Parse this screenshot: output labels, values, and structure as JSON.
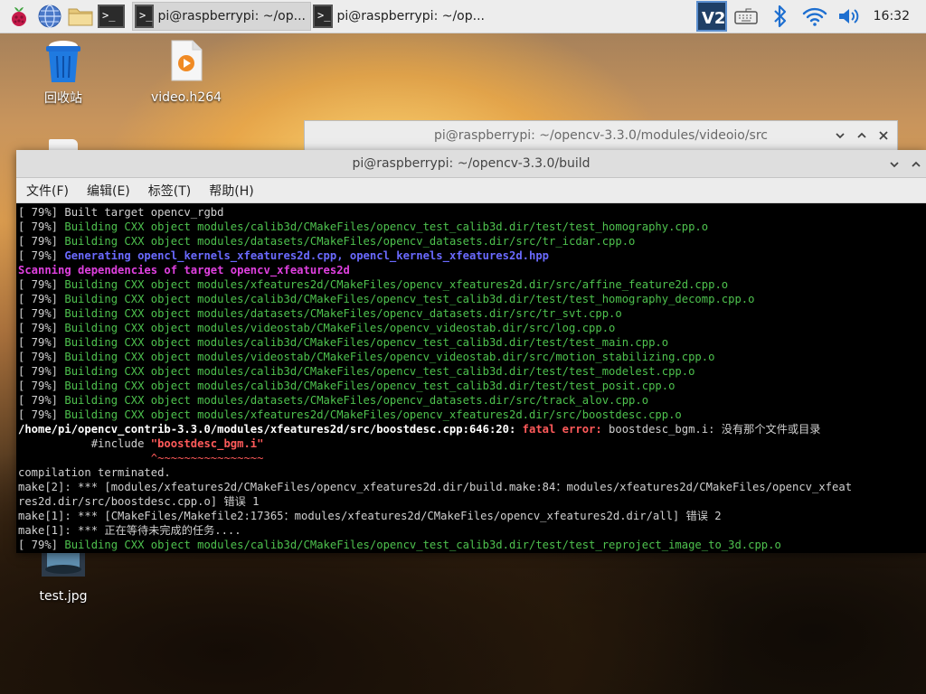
{
  "taskbar": {
    "launchers": [
      "raspberry-menu-icon",
      "browser-icon",
      "file-manager-icon",
      "terminal-icon"
    ],
    "tasks": [
      {
        "label": "pi@raspberrypi: ~/op...",
        "active": true
      },
      {
        "label": "pi@raspberrypi: ~/op...",
        "active": false
      }
    ],
    "tray": [
      "vnc-icon",
      "keyboard-icon",
      "bluetooth-icon",
      "wifi-icon",
      "volume-icon"
    ],
    "clock": "16:32"
  },
  "desktop": {
    "icons": [
      {
        "label": "回收站",
        "icon": "trash-icon"
      },
      {
        "label": "video.h264",
        "icon": "video-file-icon"
      },
      {
        "label": "test.jpg",
        "icon": "image-file-icon"
      }
    ]
  },
  "background_window": {
    "title": "pi@raspberrypi: ~/opencv-3.3.0/modules/videoio/src"
  },
  "terminal": {
    "title": "pi@raspberrypi: ~/opencv-3.3.0/build",
    "menu": [
      "文件(F)",
      "编辑(E)",
      "标签(T)",
      "帮助(H)"
    ],
    "lines": [
      [
        {
          "t": "[ 79%] Built target opencv_rgbd",
          "c": ""
        }
      ],
      [
        {
          "t": "[ 79%] ",
          "c": ""
        },
        {
          "t": "Building CXX object modules/calib3d/CMakeFiles/opencv_test_calib3d.dir/test/test_homography.cpp.o",
          "c": "g"
        }
      ],
      [
        {
          "t": "[ 79%] ",
          "c": ""
        },
        {
          "t": "Building CXX object modules/datasets/CMakeFiles/opencv_datasets.dir/src/tr_icdar.cpp.o",
          "c": "g"
        }
      ],
      [
        {
          "t": "[ 79%] ",
          "c": ""
        },
        {
          "t": "Generating opencl_kernels_xfeatures2d.cpp, opencl_kernels_xfeatures2d.hpp",
          "c": "b"
        }
      ],
      [
        {
          "t": "Scanning dependencies of target opencv_xfeatures2d",
          "c": "m"
        }
      ],
      [
        {
          "t": "[ 79%] ",
          "c": ""
        },
        {
          "t": "Building CXX object modules/xfeatures2d/CMakeFiles/opencv_xfeatures2d.dir/src/affine_feature2d.cpp.o",
          "c": "g"
        }
      ],
      [
        {
          "t": "[ 79%] ",
          "c": ""
        },
        {
          "t": "Building CXX object modules/calib3d/CMakeFiles/opencv_test_calib3d.dir/test/test_homography_decomp.cpp.o",
          "c": "g"
        }
      ],
      [
        {
          "t": "[ 79%] ",
          "c": ""
        },
        {
          "t": "Building CXX object modules/datasets/CMakeFiles/opencv_datasets.dir/src/tr_svt.cpp.o",
          "c": "g"
        }
      ],
      [
        {
          "t": "[ 79%] ",
          "c": ""
        },
        {
          "t": "Building CXX object modules/videostab/CMakeFiles/opencv_videostab.dir/src/log.cpp.o",
          "c": "g"
        }
      ],
      [
        {
          "t": "[ 79%] ",
          "c": ""
        },
        {
          "t": "Building CXX object modules/calib3d/CMakeFiles/opencv_test_calib3d.dir/test/test_main.cpp.o",
          "c": "g"
        }
      ],
      [
        {
          "t": "[ 79%] ",
          "c": ""
        },
        {
          "t": "Building CXX object modules/videostab/CMakeFiles/opencv_videostab.dir/src/motion_stabilizing.cpp.o",
          "c": "g"
        }
      ],
      [
        {
          "t": "[ 79%] ",
          "c": ""
        },
        {
          "t": "Building CXX object modules/calib3d/CMakeFiles/opencv_test_calib3d.dir/test/test_modelest.cpp.o",
          "c": "g"
        }
      ],
      [
        {
          "t": "[ 79%] ",
          "c": ""
        },
        {
          "t": "Building CXX object modules/calib3d/CMakeFiles/opencv_test_calib3d.dir/test/test_posit.cpp.o",
          "c": "g"
        }
      ],
      [
        {
          "t": "[ 79%] ",
          "c": ""
        },
        {
          "t": "Building CXX object modules/datasets/CMakeFiles/opencv_datasets.dir/src/track_alov.cpp.o",
          "c": "g"
        }
      ],
      [
        {
          "t": "[ 79%] ",
          "c": ""
        },
        {
          "t": "Building CXX object modules/xfeatures2d/CMakeFiles/opencv_xfeatures2d.dir/src/boostdesc.cpp.o",
          "c": "g"
        }
      ],
      [
        {
          "t": "/home/pi/opencv_contrib-3.3.0/modules/xfeatures2d/src/boostdesc.cpp:646:20: ",
          "c": "w"
        },
        {
          "t": "fatal error: ",
          "c": "r"
        },
        {
          "t": "boostdesc_bgm.i: 没有那个文件或目录",
          "c": ""
        }
      ],
      [
        {
          "t": "           #include ",
          "c": ""
        },
        {
          "t": "\"boostdesc_bgm.i\"",
          "c": "r"
        }
      ],
      [
        {
          "t": "                    ^~~~~~~~~~~~~~~~~",
          "c": "tilde"
        }
      ],
      [
        {
          "t": "compilation terminated.",
          "c": ""
        }
      ],
      [
        {
          "t": "make[2]: *** [modules/xfeatures2d/CMakeFiles/opencv_xfeatures2d.dir/build.make:84：modules/xfeatures2d/CMakeFiles/opencv_xfeat",
          "c": ""
        }
      ],
      [
        {
          "t": "res2d.dir/src/boostdesc.cpp.o] 错误 1",
          "c": ""
        }
      ],
      [
        {
          "t": "make[1]: *** [CMakeFiles/Makefile2:17365：modules/xfeatures2d/CMakeFiles/opencv_xfeatures2d.dir/all] 错误 2",
          "c": ""
        }
      ],
      [
        {
          "t": "make[1]: *** 正在等待未完成的任务....",
          "c": ""
        }
      ],
      [
        {
          "t": "[ 79%] ",
          "c": ""
        },
        {
          "t": "Building CXX object modules/calib3d/CMakeFiles/opencv_test_calib3d.dir/test/test_reproject_image_to_3d.cpp.o",
          "c": "g"
        }
      ]
    ]
  }
}
